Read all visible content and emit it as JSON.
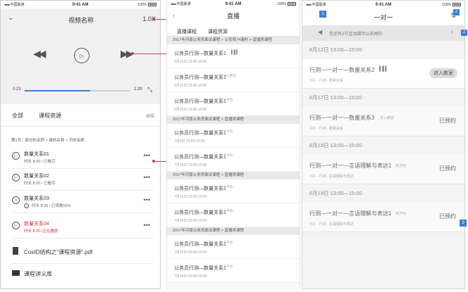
{
  "s1": {
    "status": {
      "carrier": "中国联通",
      "time": "9:41 AM",
      "battery": "100%"
    },
    "title": "视频名称",
    "speed": "1.0X",
    "progress": {
      "current": "0.23",
      "total": "2.39",
      "fraction": 0.62
    },
    "tabs": [
      "全部",
      "课程资源"
    ],
    "edit": "编辑",
    "breadcrumb": "第1节：部分的名称 > 章的名称 > 节的名称",
    "items": [
      {
        "title": "数量关系01",
        "meta": "时长 8:20  /  已看完",
        "icon": "play"
      },
      {
        "title": "数量关系02",
        "meta": "时长 8:20  /  已看完",
        "icon": "play"
      },
      {
        "title": "数量关系03",
        "meta": "时长 8:20  /  已观看50%",
        "icon": "play"
      },
      {
        "title": "数量关系04",
        "meta": "时长 8:20  /正在播放",
        "icon": "play"
      }
    ],
    "file": "CosID结构之\"课程资源\".pdf",
    "folder": "课程讲义库"
  },
  "s2": {
    "status": {
      "carrier": "中国联通",
      "time": "9:41 AM",
      "battery": "100%"
    },
    "title": "直播",
    "tabs": [
      "直播课程",
      "课程资源"
    ],
    "sections": [
      {
        "header": "2017年河南公务员面试课程 > 公安院74课时 > 直播类课程",
        "items": [
          {
            "title": "公务员行测—数量关系1",
            "date": "6月12日  13:00-15:00",
            "tag": ""
          },
          {
            "title": "公务员行测—数量关系1",
            "date": "6月12日  13:00-15:00",
            "tag": "进入教室"
          },
          {
            "title": "公务员行测—数量关系1",
            "date": "6月20日  13:00-15:00",
            "tag": "未开始"
          }
        ]
      },
      {
        "header": "2017年河南公务员面试课程 > 直播类课程",
        "items": [
          {
            "title": "公务员行测—数量关系1",
            "date": "7月2日  13:00-15:00",
            "tag": "未开始"
          },
          {
            "title": "公务员行测—数量关系1",
            "date": "7月10日  13:00-15:00",
            "tag": "未开始"
          }
        ]
      },
      {
        "header": "2017年河南公务员面试课程 > 直播类课程",
        "items": [
          {
            "title": "公务员行测—数量关系1",
            "date": "7月12日  13:00-15:00",
            "tag": "未开始"
          },
          {
            "title": "公务员行测—数量关系1",
            "date": "7月20日  13:00-15:00",
            "tag": "未开始"
          }
        ]
      },
      {
        "header": "2017年河南公务员面试课程 > 直播类课程",
        "items": [
          {
            "title": "公务员行测—数量关系1",
            "date": "7月22日  13:00-15:00",
            "tag": "未开始"
          },
          {
            "title": "公务员行测—数量关系1",
            "date": "7月24日  13:00-15:00",
            "tag": "未开始"
          }
        ]
      }
    ]
  },
  "s3": {
    "status": {
      "carrier": "中国联通",
      "time": "9:41 AM",
      "battery": "100%"
    },
    "title": "一对一",
    "badge_left": "1",
    "badge_right": "2",
    "badge_side": "3",
    "notice": "您还有2节互动课可以去预约",
    "groups": [
      {
        "date": "6月12日  13:00—15:00",
        "title": "行测—一对一—数量关系2",
        "meta": "1V1 - 行测 - 数量关系",
        "tag": "",
        "status": "进入教室",
        "active": true
      },
      {
        "date": "6月17日  13:00—15:00",
        "title": "行测—一对一—数量关系3",
        "meta": "1V1 - 行测 - 数量关系",
        "tag": "进入教室",
        "status": "已预约",
        "active": false
      },
      {
        "date": "6月19日  13:00—15:00",
        "title": "行测—一对一—言语理解与表达1",
        "meta": "1V1 - 行测 - 言语理解与表达",
        "tag": "未开始",
        "status": "已预约",
        "active": false
      },
      {
        "date": "6月19日  13:00—15:00",
        "title": "行测—一对一—言语理解与表达1",
        "meta": "1V1 - 行测 - 言语理解与表达",
        "tag": "未开始",
        "status": "已预约",
        "active": false
      }
    ]
  }
}
